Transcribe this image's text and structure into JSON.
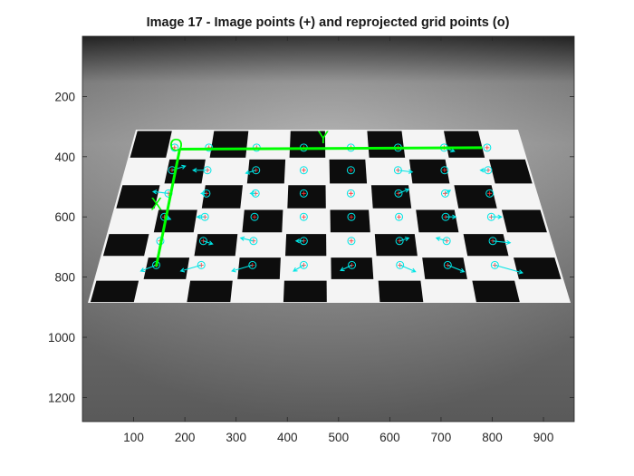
{
  "figure": {
    "title": "Image 17 - Image points (+) and reprojected grid points (o)"
  },
  "chart_data": {
    "type": "scatter",
    "title": "Image 17 - Image points (+) and reprojected grid points (o)",
    "xlabel": "",
    "ylabel": "",
    "xlim": [
      0,
      960
    ],
    "ylim": [
      1280,
      0
    ],
    "y_axis_reversed": true,
    "x_ticks": [
      100,
      200,
      300,
      400,
      500,
      600,
      700,
      800,
      900
    ],
    "y_ticks": [
      200,
      400,
      600,
      800,
      1000,
      1200
    ],
    "grid": false,
    "background": "grayscale photo of a checkerboard calibration pattern on a gray surface",
    "colors": {
      "axes_markers": "#00ff00",
      "points": "#00e5e5",
      "board_black": "#0d0d0d",
      "board_white": "#f4f4f4"
    },
    "axis_markers": {
      "origin_label": "O",
      "x_label": "X",
      "y_label": "Y"
    },
    "axis_lines": [
      {
        "name": "X",
        "points": [
          [
            190,
            375
          ],
          [
            144,
            765
          ]
        ]
      },
      {
        "name": "Y",
        "points": [
          [
            190,
            375
          ],
          [
            780,
            370
          ]
        ]
      }
    ],
    "grid_points": {
      "rows": [
        370,
        445,
        522,
        600,
        680,
        760
      ],
      "cols": [
        [
          180,
          247,
          340,
          432,
          524,
          616,
          706,
          790
        ],
        [
          175,
          244,
          339,
          432,
          524,
          616,
          707,
          792
        ],
        [
          168,
          242,
          338,
          432,
          524,
          617,
          708,
          795
        ],
        [
          160,
          239,
          336,
          432,
          525,
          618,
          709,
          798
        ],
        [
          152,
          236,
          334,
          432,
          525,
          619,
          711,
          801
        ],
        [
          144,
          232,
          332,
          432,
          526,
          620,
          713,
          805
        ]
      ],
      "error_vectors": [
        [
          [
            0,
            0
          ],
          [
            0,
            0
          ],
          [
            0,
            0
          ],
          [
            0,
            0
          ],
          [
            0,
            0
          ],
          [
            0,
            0
          ],
          [
            20,
            12
          ],
          [
            0,
            0
          ]
        ],
        [
          [
            26,
            -14
          ],
          [
            -28,
            0
          ],
          [
            -20,
            10
          ],
          [
            0,
            0
          ],
          [
            0,
            0
          ],
          [
            28,
            6
          ],
          [
            0,
            0
          ],
          [
            -15,
            0
          ]
        ],
        [
          [
            -30,
            -6
          ],
          [
            -10,
            0
          ],
          [
            -10,
            0
          ],
          [
            0,
            0
          ],
          [
            0,
            0
          ],
          [
            20,
            -14
          ],
          [
            10,
            -10
          ],
          [
            0,
            0
          ]
        ],
        [
          [
            12,
            8
          ],
          [
            -15,
            0
          ],
          [
            0,
            0
          ],
          [
            0,
            0
          ],
          [
            0,
            0
          ],
          [
            0,
            0
          ],
          [
            20,
            0
          ],
          [
            20,
            0
          ]
        ],
        [
          [
            0,
            0
          ],
          [
            18,
            10
          ],
          [
            -25,
            -10
          ],
          [
            -15,
            0
          ],
          [
            0,
            0
          ],
          [
            18,
            -10
          ],
          [
            -20,
            -10
          ],
          [
            34,
            6
          ]
        ],
        [
          [
            -30,
            20
          ],
          [
            -40,
            20
          ],
          [
            -40,
            20
          ],
          [
            -20,
            20
          ],
          [
            -22,
            18
          ],
          [
            30,
            22
          ],
          [
            32,
            22
          ],
          [
            54,
            26
          ]
        ]
      ]
    }
  }
}
